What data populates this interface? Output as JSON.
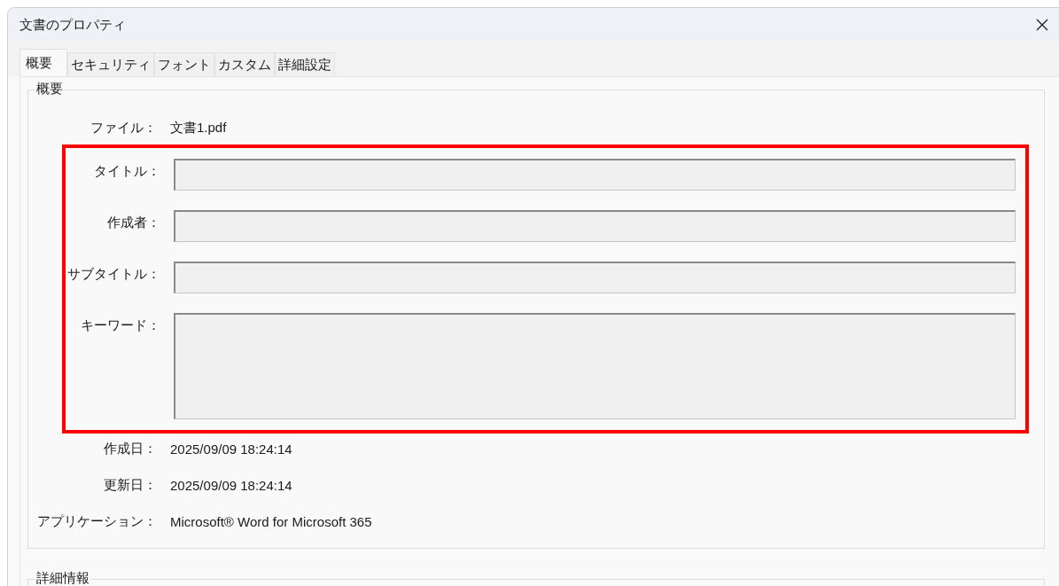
{
  "window": {
    "title": "文書のプロパティ"
  },
  "tabs": [
    {
      "label": "概要",
      "selected": true
    },
    {
      "label": "セキュリティ",
      "selected": false
    },
    {
      "label": "フォント",
      "selected": false
    },
    {
      "label": "カスタム",
      "selected": false
    },
    {
      "label": "詳細設定",
      "selected": false
    }
  ],
  "summary": {
    "legend": "概要",
    "file": {
      "label": "ファイル：",
      "value": "文書1.pdf"
    },
    "highlighted_fields": [
      {
        "label": "タイトル：",
        "kind": "line"
      },
      {
        "label": "作成者：",
        "kind": "line"
      },
      {
        "label": "サブタイトル：",
        "kind": "line"
      },
      {
        "label": "キーワード：",
        "kind": "multiline"
      }
    ],
    "info": [
      {
        "label": "作成日：",
        "value": "2025/09/09 18:24:14"
      },
      {
        "label": "更新日：",
        "value": "2025/09/09 18:24:14"
      },
      {
        "label": "アプリケーション：",
        "value": "Microsoft® Word for Microsoft 365"
      }
    ]
  },
  "details": {
    "legend": "詳細情報"
  }
}
